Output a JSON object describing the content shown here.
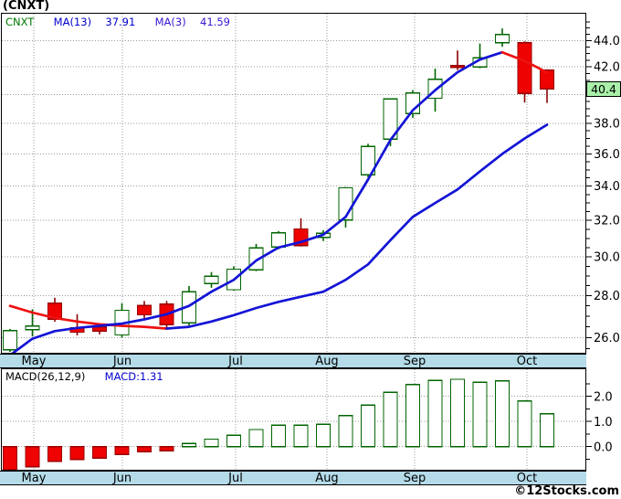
{
  "title": "(CNXT)",
  "legend": {
    "symbol": "CNXT",
    "ma13_label": "MA(13)",
    "ma13_value": "37.91",
    "ma3_label": "MA(3)",
    "ma3_value": "41.59"
  },
  "macd_header": {
    "label": "MACD(26,12,9)",
    "value_label": "MACD:1.31"
  },
  "price_tag": "40.4",
  "copyright": "©12Stocks.com",
  "months": [
    "May",
    "Jun",
    "Jul",
    "Aug",
    "Sep",
    "Oct"
  ],
  "colors": {
    "up": "#006400",
    "down_fill": "#ee0202",
    "down_stroke": "#990000",
    "down_wick": "#8b0000",
    "ma_blue": "#1414d6",
    "ma_red": "#ee1111",
    "grid": "#999999",
    "month_bar_bg": "#b5dbe9",
    "tag_bg": "#aaf0aa",
    "legend_symbol": "#007700",
    "legend_ma13": "#0000cd",
    "legend_ma3": "#3a16d0",
    "macd_value_text": "#0000cd"
  },
  "chart_data": [
    {
      "type": "candlestick",
      "title": "(CNXT) weekly price",
      "scale": "log",
      "x_months": [
        "May",
        "Jun",
        "Jul",
        "Aug",
        "Sep",
        "Oct"
      ],
      "y_axis": {
        "tick_values": [
          26,
          28,
          30,
          32,
          34,
          36,
          38,
          42,
          44
        ],
        "tick_labels": [
          "26.0",
          "28.0",
          "30.0",
          "32.0",
          "34.0",
          "36.0",
          "38.0",
          "42.0",
          "44.0"
        ],
        "grid_values": [
          26,
          28,
          30,
          32,
          34,
          36,
          38,
          40,
          42,
          44
        ],
        "minor_tick_step": 0.5,
        "range": [
          25.31,
          46.15
        ],
        "current_price": 40.4
      },
      "candles_ohlc": [
        [
          25.45,
          26.4,
          25.35,
          26.33
        ],
        [
          26.36,
          27.34,
          26.05,
          26.54
        ],
        [
          27.63,
          27.9,
          26.74,
          26.86
        ],
        [
          26.45,
          27.1,
          26.1,
          26.25
        ],
        [
          26.5,
          26.65,
          26.15,
          26.3
        ],
        [
          26.12,
          27.63,
          26.0,
          27.29
        ],
        [
          27.52,
          27.74,
          26.9,
          27.07
        ],
        [
          27.59,
          27.74,
          26.47,
          26.61
        ],
        [
          26.68,
          28.49,
          26.56,
          28.19
        ],
        [
          28.61,
          29.2,
          28.4,
          28.99
        ],
        [
          28.3,
          29.5,
          28.25,
          29.35
        ],
        [
          29.32,
          30.69,
          29.25,
          30.48
        ],
        [
          30.53,
          31.4,
          30.4,
          31.31
        ],
        [
          31.52,
          32.12,
          30.55,
          30.61
        ],
        [
          31.05,
          31.45,
          30.85,
          31.28
        ],
        [
          32.03,
          33.95,
          31.6,
          33.9
        ],
        [
          34.69,
          36.65,
          34.54,
          36.49
        ],
        [
          36.95,
          39.7,
          36.49,
          39.67
        ],
        [
          38.67,
          40.31,
          38.37,
          40.1
        ],
        [
          39.73,
          41.87,
          38.8,
          41.1
        ],
        [
          42.1,
          43.24,
          41.77,
          41.97
        ],
        [
          42.0,
          43.77,
          41.9,
          42.68
        ],
        [
          43.83,
          44.96,
          43.52,
          44.47
        ],
        [
          43.85,
          43.95,
          39.43,
          40.07
        ],
        [
          41.75,
          41.82,
          39.4,
          40.4
        ]
      ],
      "series": [
        {
          "name": "MA(3)",
          "last_value": 41.59,
          "values": [
            25.2,
            25.95,
            26.3,
            26.45,
            26.55,
            26.65,
            26.85,
            27.1,
            27.5,
            28.2,
            28.8,
            29.8,
            30.5,
            30.8,
            31.2,
            32.2,
            34.4,
            36.9,
            38.9,
            40.3,
            41.6,
            42.55,
            43.1,
            42.45,
            41.59
          ],
          "segments": [
            {
              "from": 0,
              "to": 22,
              "color": "#1414d6"
            },
            {
              "from": 22,
              "to": 24,
              "color": "#ee1111"
            }
          ]
        },
        {
          "name": "MA(13)",
          "last_value": 37.91,
          "values": [
            27.5,
            27.18,
            26.92,
            26.75,
            26.62,
            26.55,
            26.5,
            26.42,
            26.5,
            26.75,
            27.05,
            27.4,
            27.7,
            27.95,
            28.2,
            28.8,
            29.6,
            30.9,
            32.2,
            33.0,
            33.8,
            34.9,
            36.0,
            37.0,
            37.91
          ],
          "segments": [
            {
              "from": 0,
              "to": 7,
              "color": "#ee1111"
            },
            {
              "from": 7,
              "to": 24,
              "color": "#1414d6"
            }
          ]
        }
      ]
    },
    {
      "type": "bar",
      "name": "MACD(26,12,9)",
      "last_value": 1.31,
      "values": [
        -0.92,
        -0.8,
        -0.59,
        -0.51,
        -0.45,
        -0.31,
        -0.2,
        -0.17,
        0.12,
        0.3,
        0.46,
        0.68,
        0.86,
        0.86,
        0.89,
        1.23,
        1.65,
        2.16,
        2.47,
        2.64,
        2.68,
        2.56,
        2.62,
        1.81,
        1.31
      ],
      "y_axis": {
        "tick_values": [
          0,
          1,
          2
        ],
        "tick_labels": [
          "0.0",
          "1.0",
          "2.0"
        ],
        "minor_tick_values": [
          -0.5,
          0.5,
          1.5,
          2.5
        ],
        "range": [
          -0.96,
          3.12
        ]
      }
    }
  ]
}
